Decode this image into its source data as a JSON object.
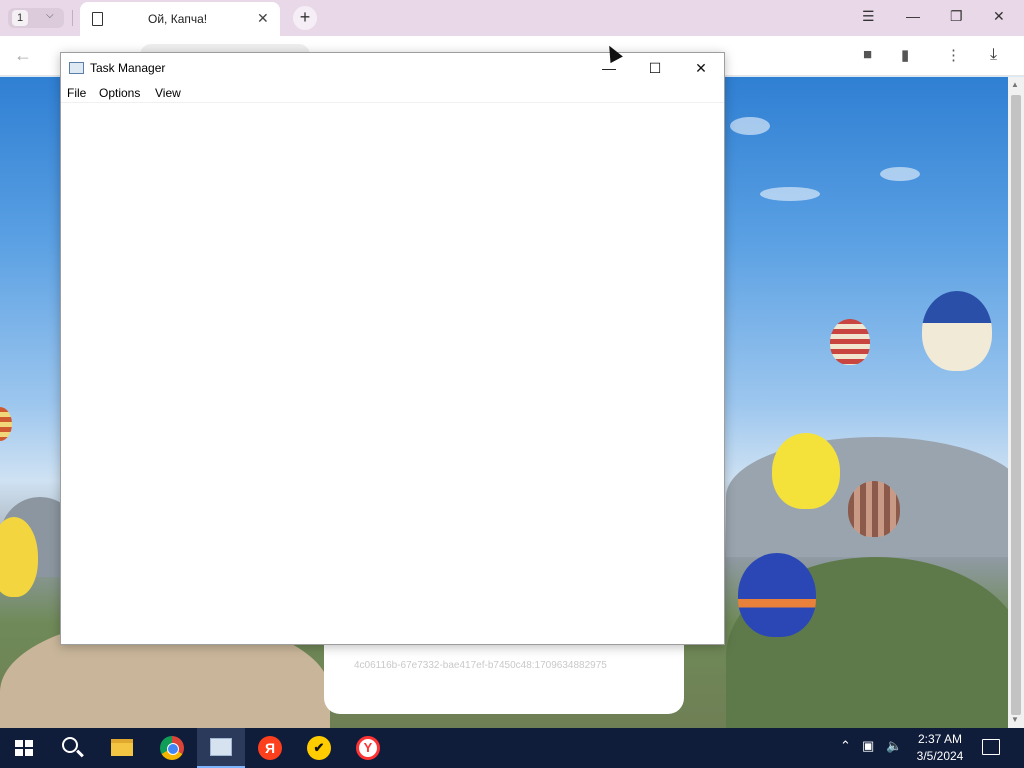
{
  "browser": {
    "tab_count": "1",
    "active_tab_title": "Ой, Капча!",
    "captcha_id": "4c06116b-67e7332-bae417ef-b7450c48:1709634882975"
  },
  "task_manager": {
    "title": "Task Manager",
    "menu": [
      "File",
      "Options",
      "View"
    ]
  },
  "taskbar": {
    "time": "2:37 AM",
    "date": "3/5/2024",
    "yandex_letter": "Я"
  },
  "icons": {
    "windows_controls": [
      "minimize-icon",
      "restore-icon",
      "close-icon"
    ],
    "taskbar_apps": [
      "start-icon",
      "search-icon",
      "file-explorer-icon",
      "chrome-icon",
      "task-manager-icon",
      "yandex-icon",
      "yandex-market-icon",
      "yandex-browser-icon"
    ]
  },
  "colors": {
    "taskbar_bg": "#0f1c3a",
    "tabbar_bg": "#e9d9e8",
    "yandex_red": "#fc3f1d"
  }
}
